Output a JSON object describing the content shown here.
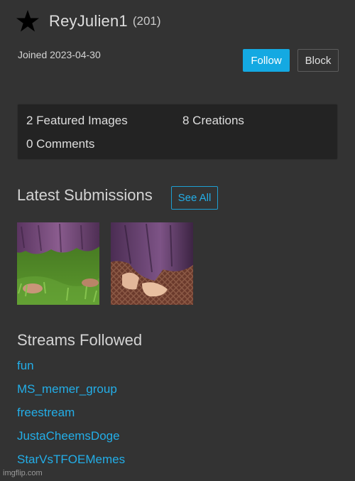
{
  "profile": {
    "username": "ReyJulien1",
    "points": "(201)",
    "joined": "Joined 2023-04-30",
    "icon": "star-icon"
  },
  "actions": {
    "follow_label": "Follow",
    "block_label": "Block"
  },
  "stats": {
    "featured": "2 Featured Images",
    "creations": "8 Creations",
    "comments": "0 Comments"
  },
  "latest": {
    "title": "Latest Submissions",
    "see_all_label": "See All",
    "images": [
      {
        "name": "submission-1"
      },
      {
        "name": "submission-2"
      }
    ]
  },
  "streams": {
    "title": "Streams Followed",
    "items": [
      "fun",
      "MS_memer_group",
      "freestream",
      "JustaCheemsDoge",
      "StarVsTFOEMemes"
    ]
  },
  "watermark": "imgflip.com",
  "colors": {
    "background": "#333333",
    "accent": "#14a9e2",
    "link": "#23aee8",
    "panel": "#232323"
  }
}
